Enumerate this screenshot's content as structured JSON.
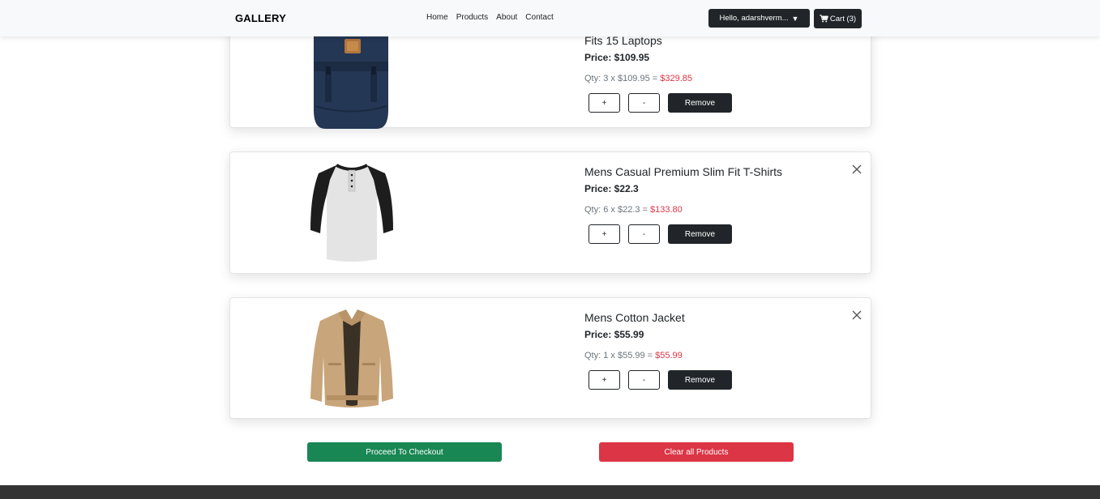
{
  "navbar": {
    "brand": "GALLERY",
    "links": [
      "Home",
      "Products",
      "About",
      "Contact"
    ],
    "user_label": "Hello, adarshverm...",
    "cart_label": "Cart (3)"
  },
  "cart_items": [
    {
      "title": "Fits 15 Laptops",
      "price": "Price: $109.95",
      "qty": "Qty: 3 x $109.95 = ",
      "total": "$329.85"
    },
    {
      "title": "Mens Casual Premium Slim Fit T-Shirts",
      "price": "Price: $22.3",
      "qty": "Qty: 6 x $22.3 = ",
      "total": "$133.80"
    },
    {
      "title": "Mens Cotton Jacket",
      "price": "Price: $55.99",
      "qty": "Qty: 1 x $55.99 = ",
      "total": "$55.99"
    }
  ],
  "buttons": {
    "plus": "+",
    "minus": "-",
    "remove": "Remove",
    "checkout": "Proceed To Checkout",
    "clear": "Clear all Products"
  },
  "colors": {
    "dark": "#212529",
    "checkout": "#198754",
    "clear": "#dc3545",
    "total_text": "#dc3545"
  }
}
